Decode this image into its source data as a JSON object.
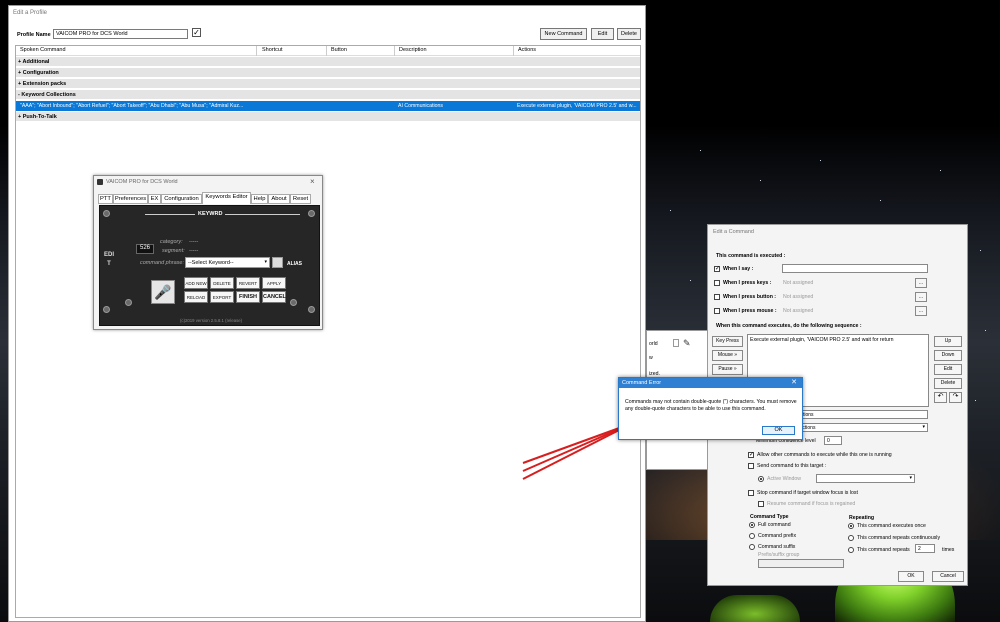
{
  "profile": {
    "title": "Edit a Profile",
    "profile_name_label": "Profile Name",
    "profile_name_value": "VAICOM PRO for DCS World",
    "buttons": {
      "new_command": "New Command",
      "edit": "Edit",
      "delete": "Delete"
    },
    "columns": [
      "Spoken Command",
      "Shortcut",
      "Button",
      "Description",
      "Actions"
    ],
    "groups": [
      "+ Additional",
      "+ Configuration",
      "+ Extension packs",
      "- Keyword Collections",
      "+ Push-To-Talk"
    ],
    "selected_row": {
      "spoken": "\"AAA\"; \"Abort Inbound\"; \"Abort Refuel\"; \"Abort Takeoff\"; \"Abu Dhabi\"; \"Abu Musa\"; \"Admiral Kuz...",
      "description": "AI Communications",
      "actions": "Execute external plugin, 'VAICOM PRO 2.5' and w..."
    }
  },
  "vaicom": {
    "title": "VAICOM PRO for DCS World",
    "tabs": [
      "PTT",
      "Preferences",
      "EX",
      "Configuration",
      "Keywords Editor",
      "Help",
      "About",
      "Reset"
    ],
    "edit_label": "EDIT",
    "keyword_title": "KEYWRD",
    "number": "526",
    "category_label": "category:",
    "category_value": "-----",
    "segment_label": "segment:",
    "segment_value": "-----",
    "command_phrase_label": "command phrase:",
    "keyword_select": "--Select Keyword--",
    "alias_label": "ALIAS",
    "buttons": [
      "ADD NEW",
      "DELETE",
      "REVERT",
      "APPLY",
      "RELOAD",
      "EXPORT",
      "FINISH",
      "CANCEL"
    ],
    "version": "(c)2019 version 2.5.8.1 (release)"
  },
  "command": {
    "title": "Edit a Command",
    "executed_label": "This command is executed :",
    "when_i_say": "When I say :",
    "when_keys": "When I press keys :",
    "when_button": "When I press button :",
    "when_mouse": "When I press mouse :",
    "not_assigned": "Not assigned",
    "ellipsis": "...",
    "sequence_label": "When this command executes, do the following sequence :",
    "side_buttons": [
      "Key Press",
      "Mouse »",
      "Pause »"
    ],
    "right_buttons": [
      "Up",
      "Down",
      "Edit",
      "Delete"
    ],
    "undo_icon": "undo-icon",
    "redo_icon": "redo-icon",
    "sequence_item": "Execute external plugin, 'VAICOM PRO 2.5' and wait for return",
    "description_partial": "unications",
    "category_partial": "Collections",
    "min_confidence": "Minimum confidence level",
    "min_conf_value": "0",
    "allow_others": "Allow other commands to execute while this one is running",
    "send_to_target": "Send command to this target :",
    "active_window": "Active Window",
    "stop_focus": "Stop command if target window focus is lost",
    "resume_focus": "Resume command if focus is regained",
    "type_title": "Command Type",
    "types": [
      "Full command",
      "Command prefix",
      "Command suffix"
    ],
    "prefix_group": "Prefix/suffix group",
    "repeat_title": "Repeating",
    "repeats": [
      "This command executes once",
      "This command repeats continuously",
      "This command repeats"
    ],
    "repeat_count": "2",
    "times": "times",
    "ok": "OK",
    "cancel": "Cancel"
  },
  "behind": {
    "fragment_1": "orld",
    "fragment_2": "w",
    "fragment_3": "ized."
  },
  "error": {
    "title": "Command Error",
    "message": "Commands may not contain double-quote (\") characters.  You must remove any double-quote characters to be able to use this command.",
    "ok": "OK",
    "close": "✕"
  },
  "colors": {
    "selection": "#0a78d7",
    "dialog_title": "#2f7fd2",
    "arrow": "#d81e1e"
  }
}
